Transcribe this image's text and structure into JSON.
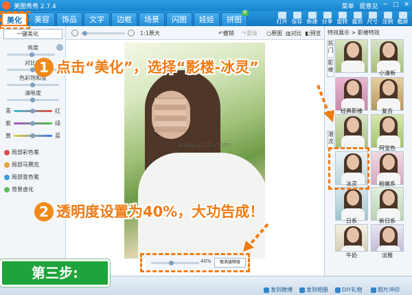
{
  "app": {
    "title": "美图秀秀 2.7.4",
    "top_links": [
      "菜单",
      "提意见"
    ]
  },
  "tabs": [
    {
      "label": "美化",
      "active": true
    },
    {
      "label": "美容"
    },
    {
      "label": "饰品"
    },
    {
      "label": "文字"
    },
    {
      "label": "边框"
    },
    {
      "label": "场景"
    },
    {
      "label": "闪图"
    },
    {
      "label": "娃娃"
    },
    {
      "label": "拼图",
      "badge": "新"
    }
  ],
  "top_tools": [
    "打开",
    "保存",
    "新建",
    "分享",
    "旋转",
    "裁剪",
    "尺寸",
    "涂鸦",
    "截屏"
  ],
  "left_panel": {
    "one_key": "一键美化",
    "sliders": [
      "亮度",
      "对比度",
      "色彩饱和度",
      "清晰度"
    ],
    "color_rows": [
      {
        "left": "青",
        "right": "红"
      },
      {
        "left": "紫",
        "right": "绿"
      },
      {
        "left": "黄",
        "right": "蓝"
      }
    ],
    "brushes": [
      "局部彩色笔",
      "局部马赛克",
      "局部变色笔",
      "背景虚化"
    ]
  },
  "toolbar": {
    "zoom_label": "1:1原大",
    "undo": "撤销",
    "redo": "重做",
    "original": "原图",
    "compare": "对比",
    "preview": "预览"
  },
  "watermark": "www.pc6.com",
  "bottom_panel": {
    "opacity": "40%",
    "cancel_button": "取消该特效"
  },
  "right_panel": {
    "breadcrumb": "特效展示 > 影楼特效",
    "vertical_tabs": [
      "热门",
      "影楼",
      "潮流"
    ],
    "thumbs": [
      {
        "label": ""
      },
      {
        "label": "小清新"
      },
      {
        "label": "经典影楼"
      },
      {
        "label": "复古"
      },
      {
        "label": ""
      },
      {
        "label": "阿宝色"
      },
      {
        "label": "冰灵"
      },
      {
        "label": "粉嫩系"
      },
      {
        "label": "日系"
      },
      {
        "label": "新日系"
      },
      {
        "label": "牛奶"
      },
      {
        "label": "淡雅"
      }
    ]
  },
  "annotations": {
    "step1_num": "1",
    "step1_text": "点击“美化”，选择“影楼-冰灵”",
    "step2_num": "2",
    "step2_text": "透明度设置为40%，大功告成！",
    "step_label": "第三步:"
  },
  "status_bar": [
    "发到微博",
    "发到相册",
    "DIY礼物",
    "照片冲印"
  ],
  "colors": {
    "accent": "#f07b15",
    "brand": "#1785cf",
    "step_bg": "#1fa33b"
  }
}
